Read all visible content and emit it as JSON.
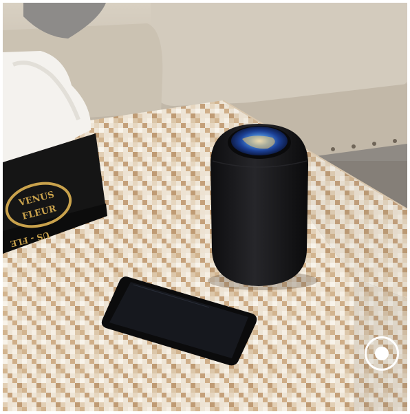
{
  "product_photo": {
    "description_alt": "Black speaker on mosaic table with phone",
    "box_brand_line1": "VENUS",
    "box_brand_line2": "FLEUR",
    "box_side_text": "US - FLE"
  },
  "carousel": {
    "indicator_state": "selected"
  },
  "colors": {
    "sofa": "#cfc6b6",
    "rug": "#8c8780",
    "table_light": "#efe6d8",
    "table_tan": "#c7a37c",
    "speaker": "#1d1d1f",
    "box": "#141414",
    "box_gold": "#c9a24c"
  }
}
